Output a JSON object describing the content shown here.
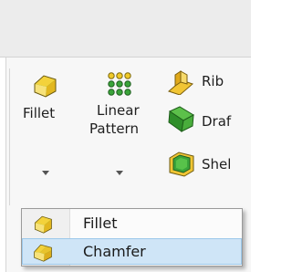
{
  "ribbon": {
    "fillet": {
      "label": "Fillet"
    },
    "linear_pattern": {
      "label_line1": "Linear",
      "label_line2": "Pattern"
    },
    "rib": {
      "label": "Rib"
    },
    "draft": {
      "label": "Draf"
    },
    "shell": {
      "label": "Shel"
    }
  },
  "dropdown_menu": {
    "items": [
      {
        "label": "Fillet",
        "icon": "fillet-icon"
      },
      {
        "label": "Chamfer",
        "icon": "chamfer-icon",
        "highlighted": true
      }
    ]
  },
  "colors": {
    "icon_yellow": "#f4d23a",
    "icon_green": "#3aa43a",
    "menu_highlight": "#cfe5f7"
  }
}
